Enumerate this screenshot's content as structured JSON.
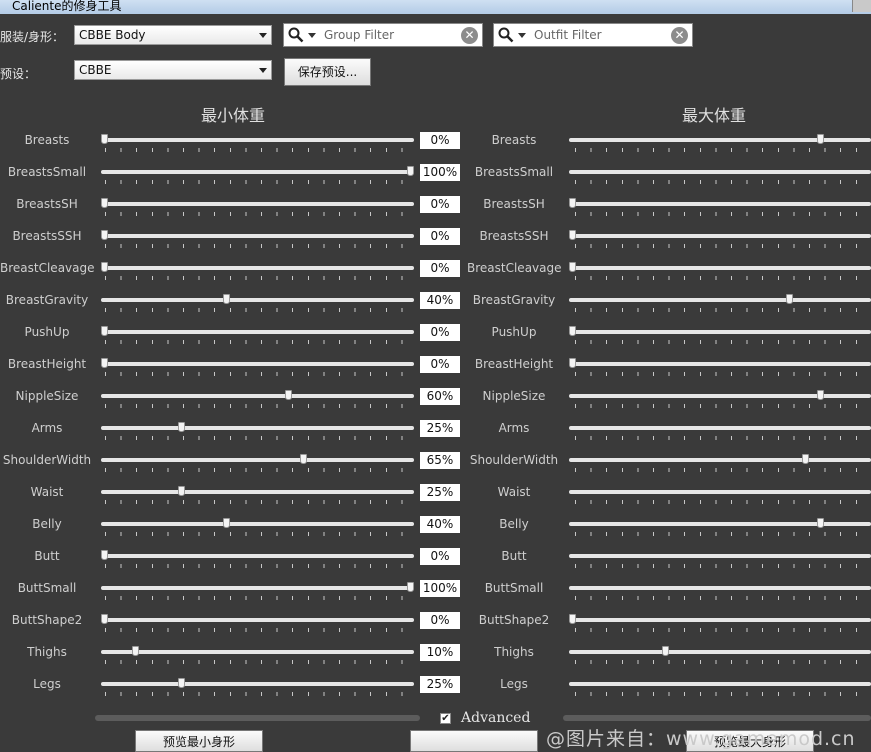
{
  "window": {
    "title": "Caliente的修身工具"
  },
  "outfit_label": "服装/身形：",
  "outfit_value": "CBBE Body",
  "preset_label": "预设：",
  "preset_value": "CBBE",
  "save_preset_label": "保存预设...",
  "group_filter_placeholder": "Group Filter",
  "outfit_filter_placeholder": "Outfit Filter",
  "min_heading": "最小体重",
  "max_heading": "最大体重",
  "advanced_label": "Advanced",
  "advanced_checked": true,
  "preview_min_label": "预览最小身形",
  "preview_max_label": "预览最大身形",
  "watermark": "@图片来自：www.gamemod.cn",
  "sliders": [
    {
      "name": "Breasts",
      "min": 0,
      "max": 80
    },
    {
      "name": "BreastsSmall",
      "min": 100,
      "max": null
    },
    {
      "name": "BreastsSH",
      "min": 0,
      "max": 0
    },
    {
      "name": "BreastsSSH",
      "min": 0,
      "max": 0
    },
    {
      "name": "BreastCleavage",
      "min": 0,
      "max": 0
    },
    {
      "name": "BreastGravity",
      "min": 40,
      "max": 70
    },
    {
      "name": "PushUp",
      "min": 0,
      "max": 0
    },
    {
      "name": "BreastHeight",
      "min": 0,
      "max": 0
    },
    {
      "name": "NippleSize",
      "min": 60,
      "max": 80
    },
    {
      "name": "Arms",
      "min": 25,
      "max": null
    },
    {
      "name": "ShoulderWidth",
      "min": 65,
      "max": 75
    },
    {
      "name": "Waist",
      "min": 25,
      "max": null
    },
    {
      "name": "Belly",
      "min": 40,
      "max": 80
    },
    {
      "name": "Butt",
      "min": 0,
      "max": null
    },
    {
      "name": "ButtSmall",
      "min": 100,
      "max": null
    },
    {
      "name": "ButtShape2",
      "min": 0,
      "max": 0
    },
    {
      "name": "Thighs",
      "min": 10,
      "max": 30
    },
    {
      "name": "Legs",
      "min": 25,
      "max": null
    }
  ]
}
